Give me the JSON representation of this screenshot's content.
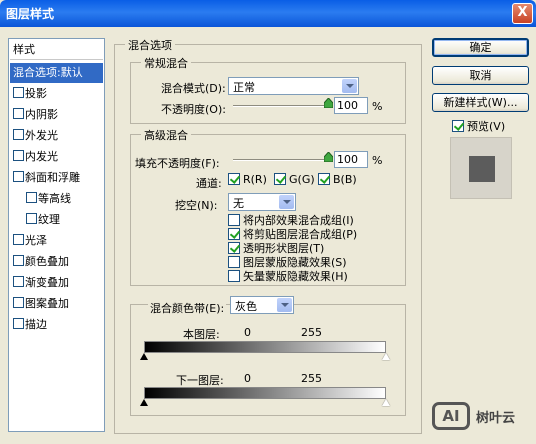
{
  "window": {
    "title": "图层样式",
    "close_glyph": "X"
  },
  "sidebar": {
    "header": "样式",
    "items": [
      {
        "label": "混合选项:默认",
        "checkbox": false,
        "selected": true
      },
      {
        "label": "投影",
        "checkbox": true,
        "checked": false
      },
      {
        "label": "内阴影",
        "checkbox": true,
        "checked": false
      },
      {
        "label": "外发光",
        "checkbox": true,
        "checked": false
      },
      {
        "label": "内发光",
        "checkbox": true,
        "checked": false
      },
      {
        "label": "斜面和浮雕",
        "checkbox": true,
        "checked": false
      },
      {
        "label": "等高线",
        "checkbox": true,
        "checked": false
      },
      {
        "label": "纹理",
        "checkbox": true,
        "checked": false
      },
      {
        "label": "光泽",
        "checkbox": true,
        "checked": false
      },
      {
        "label": "颜色叠加",
        "checkbox": true,
        "checked": false
      },
      {
        "label": "渐变叠加",
        "checkbox": true,
        "checked": false
      },
      {
        "label": "图案叠加",
        "checkbox": true,
        "checked": false
      },
      {
        "label": "描边",
        "checkbox": true,
        "checked": false
      }
    ]
  },
  "blending": {
    "section_title": "混合选项",
    "general": {
      "title": "常规混合",
      "mode_label": "混合模式(D):",
      "mode_value": "正常",
      "opacity_label": "不透明度(O):",
      "opacity_value": "100",
      "percent": "%"
    },
    "advanced": {
      "title": "高级混合",
      "fill_label": "填充不透明度(F):",
      "fill_value": "100",
      "percent": "%",
      "channels_label": "通道:",
      "channel_r": "R(R)",
      "channel_g": "G(G)",
      "channel_b": "B(B)",
      "knockout_label": "挖空(N):",
      "knockout_value": "无",
      "options": [
        {
          "label": "将内部效果混合成组(I)",
          "checked": false
        },
        {
          "label": "将剪贴图层混合成组(P)",
          "checked": true
        },
        {
          "label": "透明形状图层(T)",
          "checked": true
        },
        {
          "label": "图层蒙版隐藏效果(S)",
          "checked": false
        },
        {
          "label": "矢量蒙版隐藏效果(H)",
          "checked": false
        }
      ]
    },
    "blend_if": {
      "label": "混合颜色带(E):",
      "value": "灰色",
      "this_layer_label": "本图层:",
      "this_layer_min": "0",
      "this_layer_max": "255",
      "underlying_label": "下一图层:",
      "underlying_min": "0",
      "underlying_max": "255"
    }
  },
  "buttons": {
    "ok": "确定",
    "cancel": "取消",
    "new_style": "新建样式(W)...",
    "preview_label": "预览(V)"
  },
  "watermark": {
    "logo": "AI",
    "text": "树叶云"
  }
}
